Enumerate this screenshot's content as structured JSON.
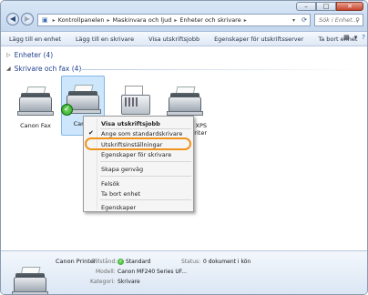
{
  "address": {
    "crumbs": [
      "Kontrollpanelen",
      "Maskinvara och ljud",
      "Enheter och skrivare"
    ]
  },
  "search": {
    "placeholder": "Sök i Enhet..."
  },
  "toolbar": {
    "items": [
      "Lägg till en enhet",
      "Lägg till en skrivare",
      "Visa utskriftsjobb",
      "Egenskaper för utskriftsserver",
      "Ta bort enhet"
    ]
  },
  "groups": {
    "devices": "Enheter (4)",
    "printers": "Skrivare och fax (4)"
  },
  "devices": [
    {
      "label": "Canon Fax",
      "icon": "fax-printer-icon"
    },
    {
      "label": "Canon",
      "icon": "printer-icon",
      "selected": true,
      "default": true
    },
    {
      "label": "",
      "icon": "fax-machine-icon"
    },
    {
      "label": "t XPS\nWriter",
      "icon": "printer-icon"
    }
  ],
  "context_menu": {
    "items": [
      "Visa utskriftsjobb",
      "Ange som standardskrivare",
      "Utskriftsinställningar",
      "Egenskaper för skrivare",
      "Skapa genväg",
      "Felsök",
      "Ta bort enhet",
      "Egenskaper"
    ],
    "highlight_color": "#f0931c"
  },
  "details": {
    "name": "Canon Printer",
    "labels": {
      "state": "Tillstånd:",
      "model": "Modell:",
      "category": "Kategori:",
      "status": "Status:"
    },
    "values": {
      "state": "Standard",
      "model": "Canon MF240 Series UF...",
      "category": "Skrivare",
      "status": "0 dokument i kön"
    }
  }
}
